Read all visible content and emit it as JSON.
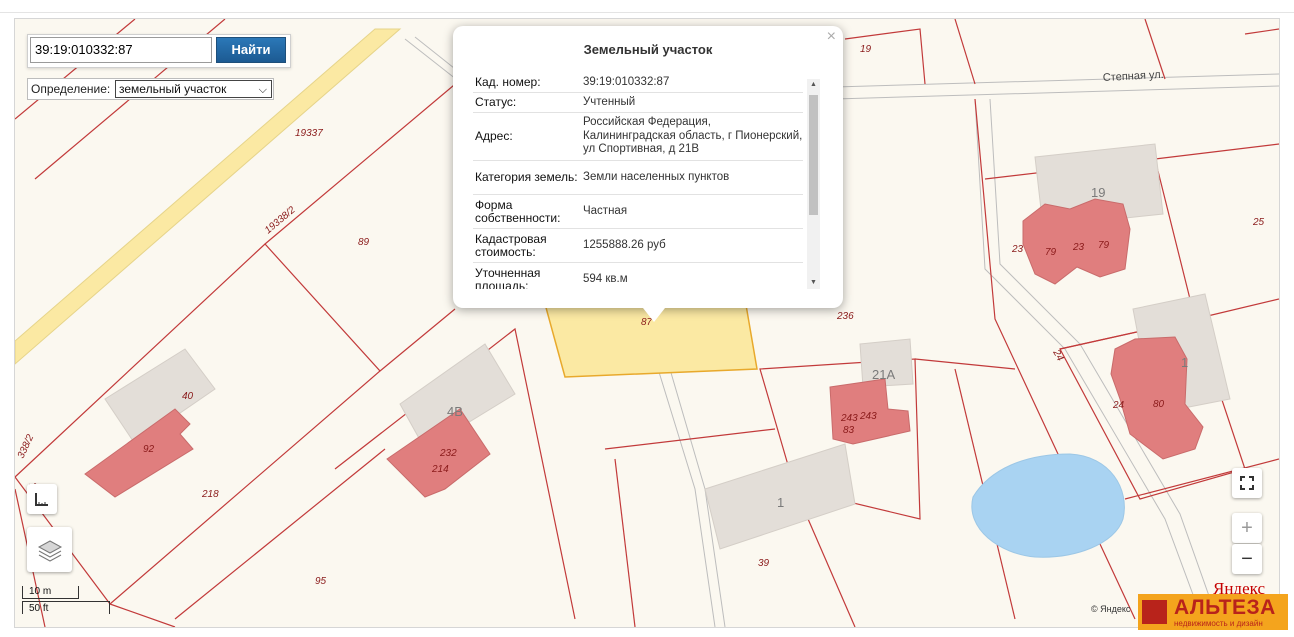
{
  "search": {
    "value": "39:19:010332:87",
    "button_label": "Найти"
  },
  "definition": {
    "label": "Определение:",
    "selected": "земельный участок"
  },
  "popup": {
    "title": "Земельный участок",
    "rows": [
      {
        "key": "Кад. номер:",
        "value": "39:19:010332:87"
      },
      {
        "key": "Статус:",
        "value": "Учтенный"
      },
      {
        "key": "Адрес:",
        "value": "Российская Федерация, Калининградская область, г Пионерский, ул Спортивная, д 21В"
      },
      {
        "key": "Категория земель:",
        "value": "Земли населенных пунктов"
      },
      {
        "key": "Форма собственности:",
        "value": "Частная"
      },
      {
        "key": "Кадастровая стоимость:",
        "value": "1255888.26 руб"
      },
      {
        "key": "Уточненная площадь:",
        "value": "594 кв.м"
      }
    ]
  },
  "map": {
    "street_label": "Степная ул.",
    "parcel_labels": [
      "19337",
      "19338/2",
      "89",
      "218",
      "95",
      "40",
      "92",
      "232",
      "214",
      "236",
      "21A",
      "243",
      "243",
      "83",
      "1",
      "39",
      "19",
      "79",
      "23",
      "79",
      "23",
      "25",
      "24",
      "24",
      "80",
      "87",
      "19",
      "338/2",
      "21"
    ],
    "building_labels": [
      "4B",
      "21A",
      "1",
      "19",
      "1"
    ]
  },
  "scale": {
    "metric": "10 m",
    "imperial": "50 ft"
  },
  "attribution": {
    "copyright": "© Яндекс",
    "logo": "Яндекс"
  },
  "watermark": {
    "name": "АЛЬТЕЗА",
    "tagline": "недвижимость и дизайн"
  }
}
